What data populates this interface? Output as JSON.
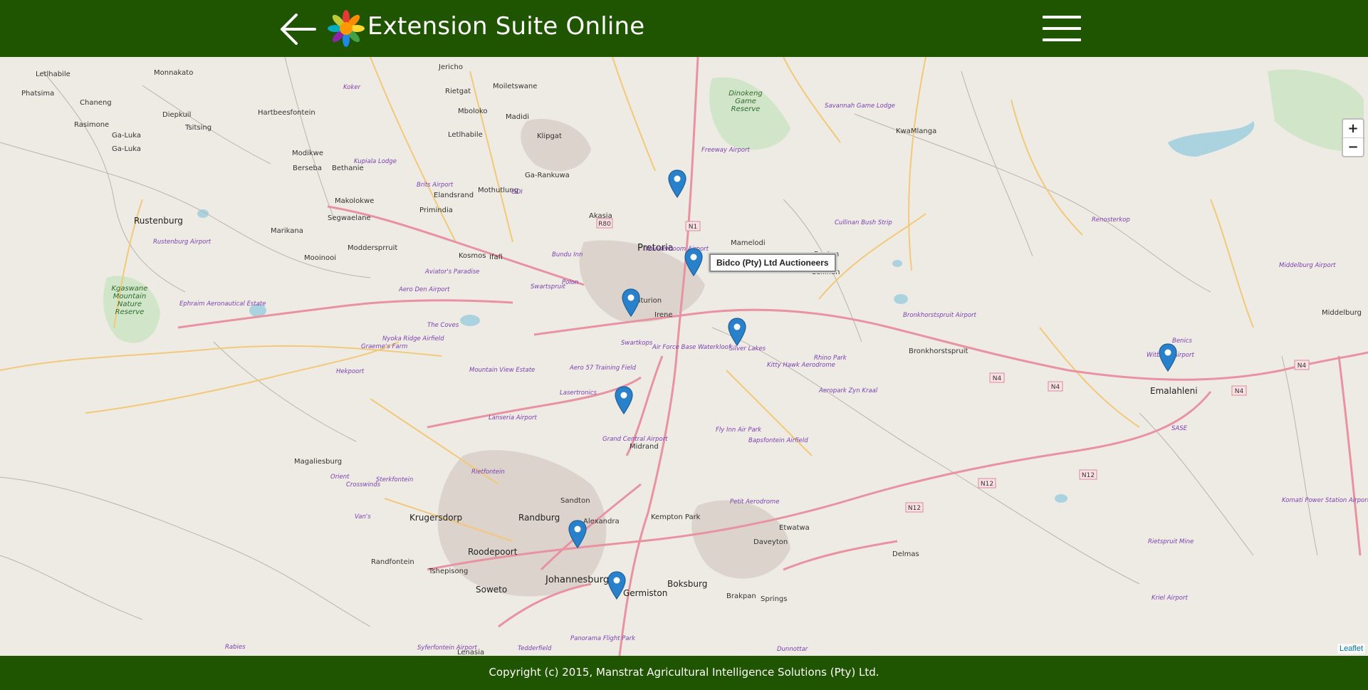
{
  "header": {
    "title": "Extension Suite Online",
    "back_icon": "arrow-left-icon",
    "logo_icon": "sunflower-logo",
    "menu_icon": "hamburger-menu-icon",
    "background_color": "#1f5500"
  },
  "map": {
    "marker_color": "#2a81cb",
    "tooltip": "Bidco (Pty) Ltd Auctioneers",
    "zoom_in": "+",
    "zoom_out": "−",
    "attribution": "Leaflet",
    "places": [
      "Letlhabile",
      "Monnakato",
      "Phatsima",
      "Chaneng",
      "Diepkuil",
      "Hartbeesfontein",
      "Rasimone",
      "Tsitsing",
      "Ga-Luka",
      "Ga-Luka",
      "Modikwe",
      "Berseba",
      "Bethanie",
      "Makolokwe",
      "Segwaelane",
      "Rustenburg",
      "Marikana",
      "Moddersprruit",
      "Mooinooi",
      "Jericho",
      "Rietgat",
      "Moiletswane",
      "Mboloko",
      "Madidi",
      "Letlhabile",
      "Klipgat",
      "Ga-Rankuwa",
      "Mothutlung",
      "Elandsrand",
      "Primindia",
      "Akasia",
      "Kosmos",
      "Ifafi",
      "Pretoria",
      "Centurion",
      "Irene",
      "Mamelodi",
      "Rayton",
      "Cullinan",
      "KwaMlanga",
      "Bronkhorstspruit",
      "Middelburg",
      "Emalahleni",
      "Midrand",
      "Magaliesburg",
      "Krugersdorp",
      "Randburg",
      "Sandton",
      "Alexandra",
      "Kempton Park",
      "Etwatwa",
      "Daveyton",
      "Roodepoort",
      "Randfontein",
      "Tshepisong",
      "Johannesburg",
      "Germiston",
      "Boksburg",
      "Soweto",
      "Brakpan",
      "Springs",
      "Delmas",
      "Lenasia"
    ],
    "airports": [
      "Koker",
      "Kupiala Lodge",
      "Brits Airport",
      "ODI",
      "Freeway Airport",
      "Wonderboom Airport",
      "Bundu Inn",
      "Swartspruit",
      "Polon",
      "Aviator's Paradise",
      "Aero Den Airport",
      "Rustenburg Airport",
      "Ephraim Aeronautical Estate",
      "Nyoka Ridge Airfield",
      "Graeme's Farm",
      "The Coves",
      "Hekpoort",
      "Mountain View Estate",
      "Aero 57 Training Field",
      "Lasertronics",
      "Lanseria Airport",
      "Swartkops",
      "Air Force Base Waterkloof",
      "Silver Lakes",
      "Kitty Hawk Aerodrome",
      "Rhino Park",
      "Aeropark Zyn Kraal",
      "Cullinan Bush Strip",
      "Savannah Game Lodge",
      "Bronkhorstspruit Airport",
      "Renosterkop",
      "Middelburg Airport",
      "Benics",
      "Witbank Airport",
      "SASE",
      "Grand Central Airport",
      "Fly Inn Air Park",
      "Bapsfontein Airfield",
      "Petit Aerodrome",
      "Komati Power Station Airport",
      "Rietspruit Mine",
      "Kriel Airport",
      "Orient",
      "Crosswinds",
      "Sterkfontein",
      "Van's",
      "Rietfontein",
      "Rabies",
      "Syferfontein Airport",
      "Tedderfield",
      "Panorama Flight Park",
      "Dunnottar"
    ],
    "parks": [
      "Dinokeng Game Reserve",
      "Kgaswane Mountain Nature Reserve"
    ],
    "road_shields": [
      "R80",
      "N1",
      "N4",
      "N4",
      "N4",
      "N4",
      "N12",
      "N12",
      "N12"
    ]
  },
  "footer": {
    "copyright": "Copyright (c) 2015, Manstrat Agricultural Intelligence Solutions (Pty) Ltd."
  }
}
